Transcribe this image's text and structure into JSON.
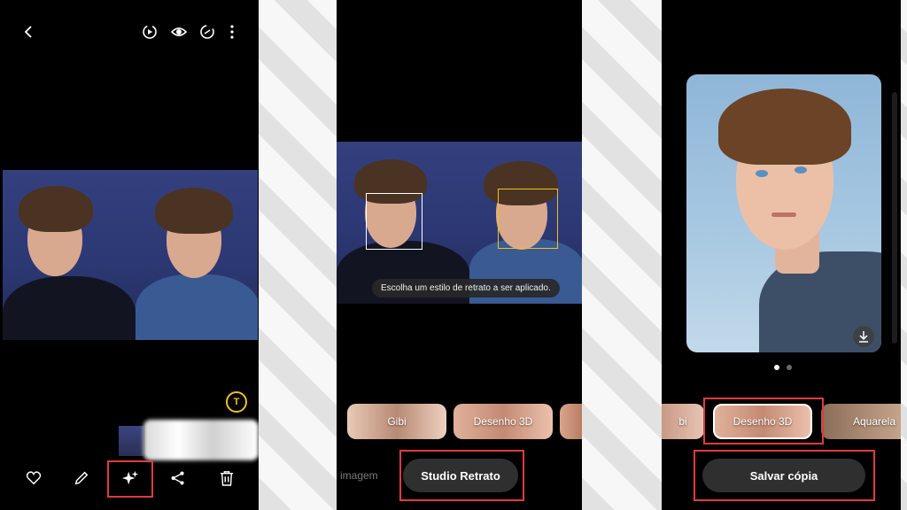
{
  "panel_a": {
    "toolbar_icons": [
      "back-icon",
      "motion-photo-icon",
      "eye-icon",
      "rotate-icon",
      "more-icon"
    ],
    "text_detect_icon": "T",
    "bottom_icons": [
      "heart-icon",
      "pencil-icon",
      "sparkle-icon",
      "share-icon",
      "trash-icon"
    ]
  },
  "panel_b": {
    "hint": "Escolha um estilo de retrato a ser aplicado.",
    "styles": [
      "Gibi",
      "Desenho 3D"
    ],
    "tab_left": "imagem",
    "studio_button": "Studio Retrato"
  },
  "panel_c": {
    "styles": [
      "bi",
      "Desenho 3D",
      "Aquarela"
    ],
    "save_button": "Salvar cópia",
    "page_dots": 2,
    "active_dot": 0
  },
  "colors": {
    "highlight": "#e23b3b",
    "face_box_default": "#ffffff",
    "face_box_selected": "#f2c21b",
    "photo_bg": "#2f3a77"
  }
}
